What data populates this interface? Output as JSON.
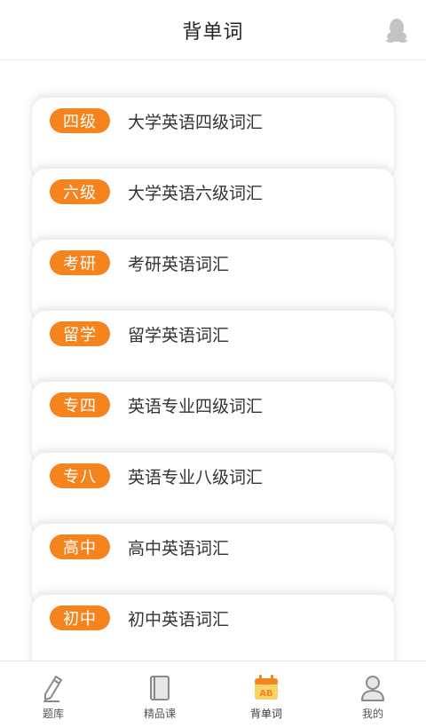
{
  "header": {
    "title": "背单词"
  },
  "vocab_list": [
    {
      "badge": "四级",
      "label": "大学英语四级词汇"
    },
    {
      "badge": "六级",
      "label": "大学英语六级词汇"
    },
    {
      "badge": "考研",
      "label": "考研英语词汇"
    },
    {
      "badge": "留学",
      "label": "留学英语词汇"
    },
    {
      "badge": "专四",
      "label": "英语专业四级词汇"
    },
    {
      "badge": "专八",
      "label": "英语专业八级词汇"
    },
    {
      "badge": "高中",
      "label": "高中英语词汇"
    },
    {
      "badge": "初中",
      "label": "初中英语词汇"
    }
  ],
  "tabbar": {
    "tabs": [
      {
        "label": "题库",
        "icon": "pencil-icon",
        "active": false
      },
      {
        "label": "精品课",
        "icon": "book-icon",
        "active": false
      },
      {
        "label": "背单词",
        "icon": "calendar-ab-icon",
        "active": true
      },
      {
        "label": "我的",
        "icon": "person-icon",
        "active": false
      }
    ]
  },
  "colors": {
    "accent": "#f5841f",
    "text": "#333333",
    "tab_icon": "#8a8a8a"
  }
}
